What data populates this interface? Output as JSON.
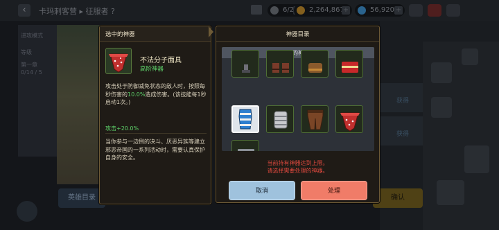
{
  "background": {
    "crumb": "卡玛刺客营 ▸ 征服者 ?",
    "resources": [
      {
        "name": "level",
        "value": "6/25"
      },
      {
        "name": "gold",
        "value": "2,264,867"
      },
      {
        "name": "gem",
        "value": "56,920"
      }
    ],
    "left_rows": [
      "进攻模式",
      "等级",
      "第一章",
      "0/14 / 5"
    ],
    "row_labels": [
      "获得",
      "获得"
    ],
    "hero_button": "英雄目录",
    "confirm_button": "确认"
  },
  "detail": {
    "title": "选中的神器",
    "item_name": "不法分子面具",
    "item_grade": "高阶神器",
    "desc_before": "攻击处于防御减免状态的敌人时，按照每秒伤害的",
    "desc_highlight": "10.0%",
    "desc_after": "造成伤害。(该技能每1秒启动1次。)",
    "attack_bonus": "攻击+20.0%",
    "lore": "当你参与一边倒的决斗、厌恶异族等建立邪恶帝国的一系列活动时，需要认真保护自身的安全。"
  },
  "catalog": {
    "title": "神器目录",
    "tab": "我的神器",
    "items": [
      {
        "icon": "staff-icon",
        "selected": false
      },
      {
        "icon": "boots-icon",
        "selected": false
      },
      {
        "icon": "gauntlet-icon",
        "selected": false
      },
      {
        "icon": "red-chest-icon",
        "selected": false
      },
      {
        "icon": "blue-armor-icon",
        "selected": true
      },
      {
        "icon": "armguard-icon",
        "selected": false
      },
      {
        "icon": "leather-pants-icon",
        "selected": false
      },
      {
        "icon": "bandana-mask-icon",
        "selected": false
      },
      {
        "icon": "revolver-icon",
        "selected": false
      }
    ],
    "warning_line1": "当前持有神器达到上限。",
    "warning_line2": "请选择需要处理的神器。",
    "cancel_label": "取消",
    "process_label": "处理"
  },
  "colors": {
    "panel_bg": "#1f1b16",
    "panel_border": "#6d5a36",
    "grade_green": "#5ed36a",
    "warning_red": "#e0493e",
    "cancel_blue": "#9fc2dd",
    "process_red": "#f07c68"
  }
}
